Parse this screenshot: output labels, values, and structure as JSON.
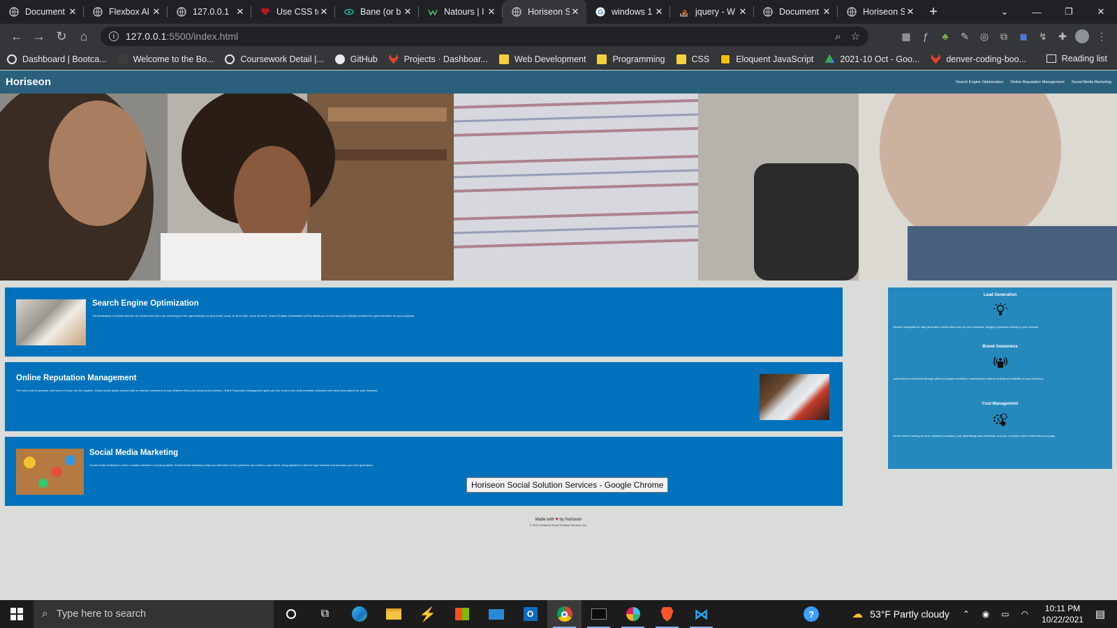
{
  "browser": {
    "tabs": [
      {
        "title": "Document",
        "favicon": "globe-icon",
        "active": false
      },
      {
        "title": "Flexbox Al",
        "favicon": "globe-icon",
        "active": false
      },
      {
        "title": "127.0.0.1",
        "favicon": "globe-icon",
        "active": false
      },
      {
        "title": "Use CSS te",
        "favicon": "heart-icon",
        "active": false
      },
      {
        "title": "Bane (or b",
        "favicon": "eye-icon",
        "active": false
      },
      {
        "title": "Natours | I",
        "favicon": "leaf-icon",
        "active": false
      },
      {
        "title": "Horiseon S",
        "favicon": "globe-icon",
        "active": true
      },
      {
        "title": "windows 1",
        "favicon": "google-icon",
        "active": false
      },
      {
        "title": "jquery - W",
        "favicon": "stackoverflow-icon",
        "active": false
      },
      {
        "title": "Document",
        "favicon": "globe-icon",
        "active": false
      },
      {
        "title": "Horiseon S",
        "favicon": "globe-icon",
        "active": false
      }
    ],
    "new_tab_label": "+",
    "url_host": "127.0.0.1",
    "url_path": ":5500/index.html",
    "bookmarks": [
      {
        "label": "Dashboard | Bootca...",
        "icon": "globe-icon",
        "color": "#e8eaed"
      },
      {
        "label": "Welcome to the Bo...",
        "icon": "page-icon",
        "color": "#3c3c3c"
      },
      {
        "label": "Coursework Detail |...",
        "icon": "globe-icon",
        "color": "#e8eaed"
      },
      {
        "label": "GitHub",
        "icon": "github-icon",
        "color": "#e8eaed"
      },
      {
        "label": "Projects · Dashboar...",
        "icon": "gitlab-icon",
        "color": "#e24329"
      },
      {
        "label": "Web Development",
        "icon": "folder-icon",
        "color": "#f4d03f"
      },
      {
        "label": "Programming",
        "icon": "folder-icon",
        "color": "#f4d03f"
      },
      {
        "label": "CSS",
        "icon": "folder-icon",
        "color": "#f4d03f"
      },
      {
        "label": "Eloquent JavaScript",
        "icon": "js-icon",
        "color": "#f0c200"
      },
      {
        "label": "2021-10 Oct - Goo...",
        "icon": "drive-icon",
        "color": "#34a853"
      },
      {
        "label": "denver-coding-boo...",
        "icon": "gitlab-icon",
        "color": "#e24329"
      }
    ],
    "reading_list": "Reading list"
  },
  "site": {
    "title": "Horiseon",
    "nav": [
      "Search Engine Optimization",
      "Online Reputation Management",
      "Social Media Marketing"
    ],
    "cards": [
      {
        "heading": "Search Engine Optimization",
        "text": "The dominance of mobile internet use means that users are searching for the right business as they travel, shop, or sit on their couch at home. Search Engine Optimization (SEO) allows you to increase your visibility and find the right customers for your business."
      },
      {
        "heading": "Online Reputation Management",
        "text": "The web is full of opinions, and some of those can be negative. Social media allows anyone with an internet connection to say whatever they want about your business. Online Reputation Management gives you the control over what potential customers see when they search for your business."
      },
      {
        "heading": "Social Media Marketing",
        "text": "Social media continues to have a sizable influence on buying habits. Social media marketing helps you determine which platforms are suited to your brand, using analytics to find the right markets and increase your lead generation."
      }
    ],
    "benefits": [
      {
        "heading": "Lead Generation",
        "text": "Inbound strategies for lead generation require less work for your business, bringing customers directly to your website."
      },
      {
        "heading": "Brand Awareness",
        "text": "Users find your business through paid and organic searches, increasing the search ranking and visibility for your business."
      },
      {
        "heading": "Cost Management",
        "text": "As the search ranking for your business increases, your advertising costs decrease, and you no longer need to advertise your page."
      }
    ],
    "footer_made": "Made with",
    "footer_by": "by Horiseon",
    "footer_copy": "© 2019 Horiseon Social Solution Services, Inc."
  },
  "tooltip": "Horiseon Social Solution Services - Google Chrome",
  "taskbar": {
    "search_placeholder": "Type here to search",
    "weather": "53°F  Partly cloudy",
    "time": "10:11 PM",
    "date": "10/22/2021"
  },
  "colors": {
    "header": "#2a607c",
    "card": "#0072bb",
    "sidebar": "#2589bd"
  }
}
